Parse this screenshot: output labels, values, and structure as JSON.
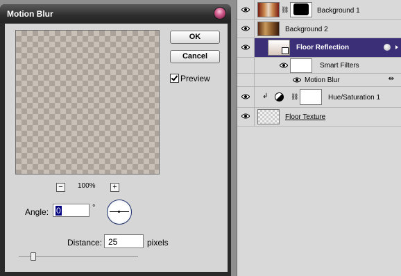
{
  "dialog": {
    "title": "Motion Blur",
    "ok_label": "OK",
    "cancel_label": "Cancel",
    "preview_label": "Preview",
    "preview_checked": true,
    "zoom_out_label": "−",
    "zoom_in_label": "+",
    "zoom_level": "100%",
    "angle_label": "Angle:",
    "angle_value": "0",
    "angle_unit": "°",
    "distance_label": "Distance:",
    "distance_value": "25",
    "distance_unit": "pixels"
  },
  "layers": {
    "items": [
      {
        "label": "Background 1"
      },
      {
        "label": "Background 2"
      },
      {
        "label": "Floor Reflection"
      },
      {
        "label": "Smart Filters"
      },
      {
        "label": "Motion Blur"
      },
      {
        "label": "Hue/Saturation 1"
      },
      {
        "label": "Floor Texture"
      }
    ]
  },
  "colors": {
    "selected_layer": "#3b2f78",
    "dialog_title_bg": "#2e2e2e"
  }
}
